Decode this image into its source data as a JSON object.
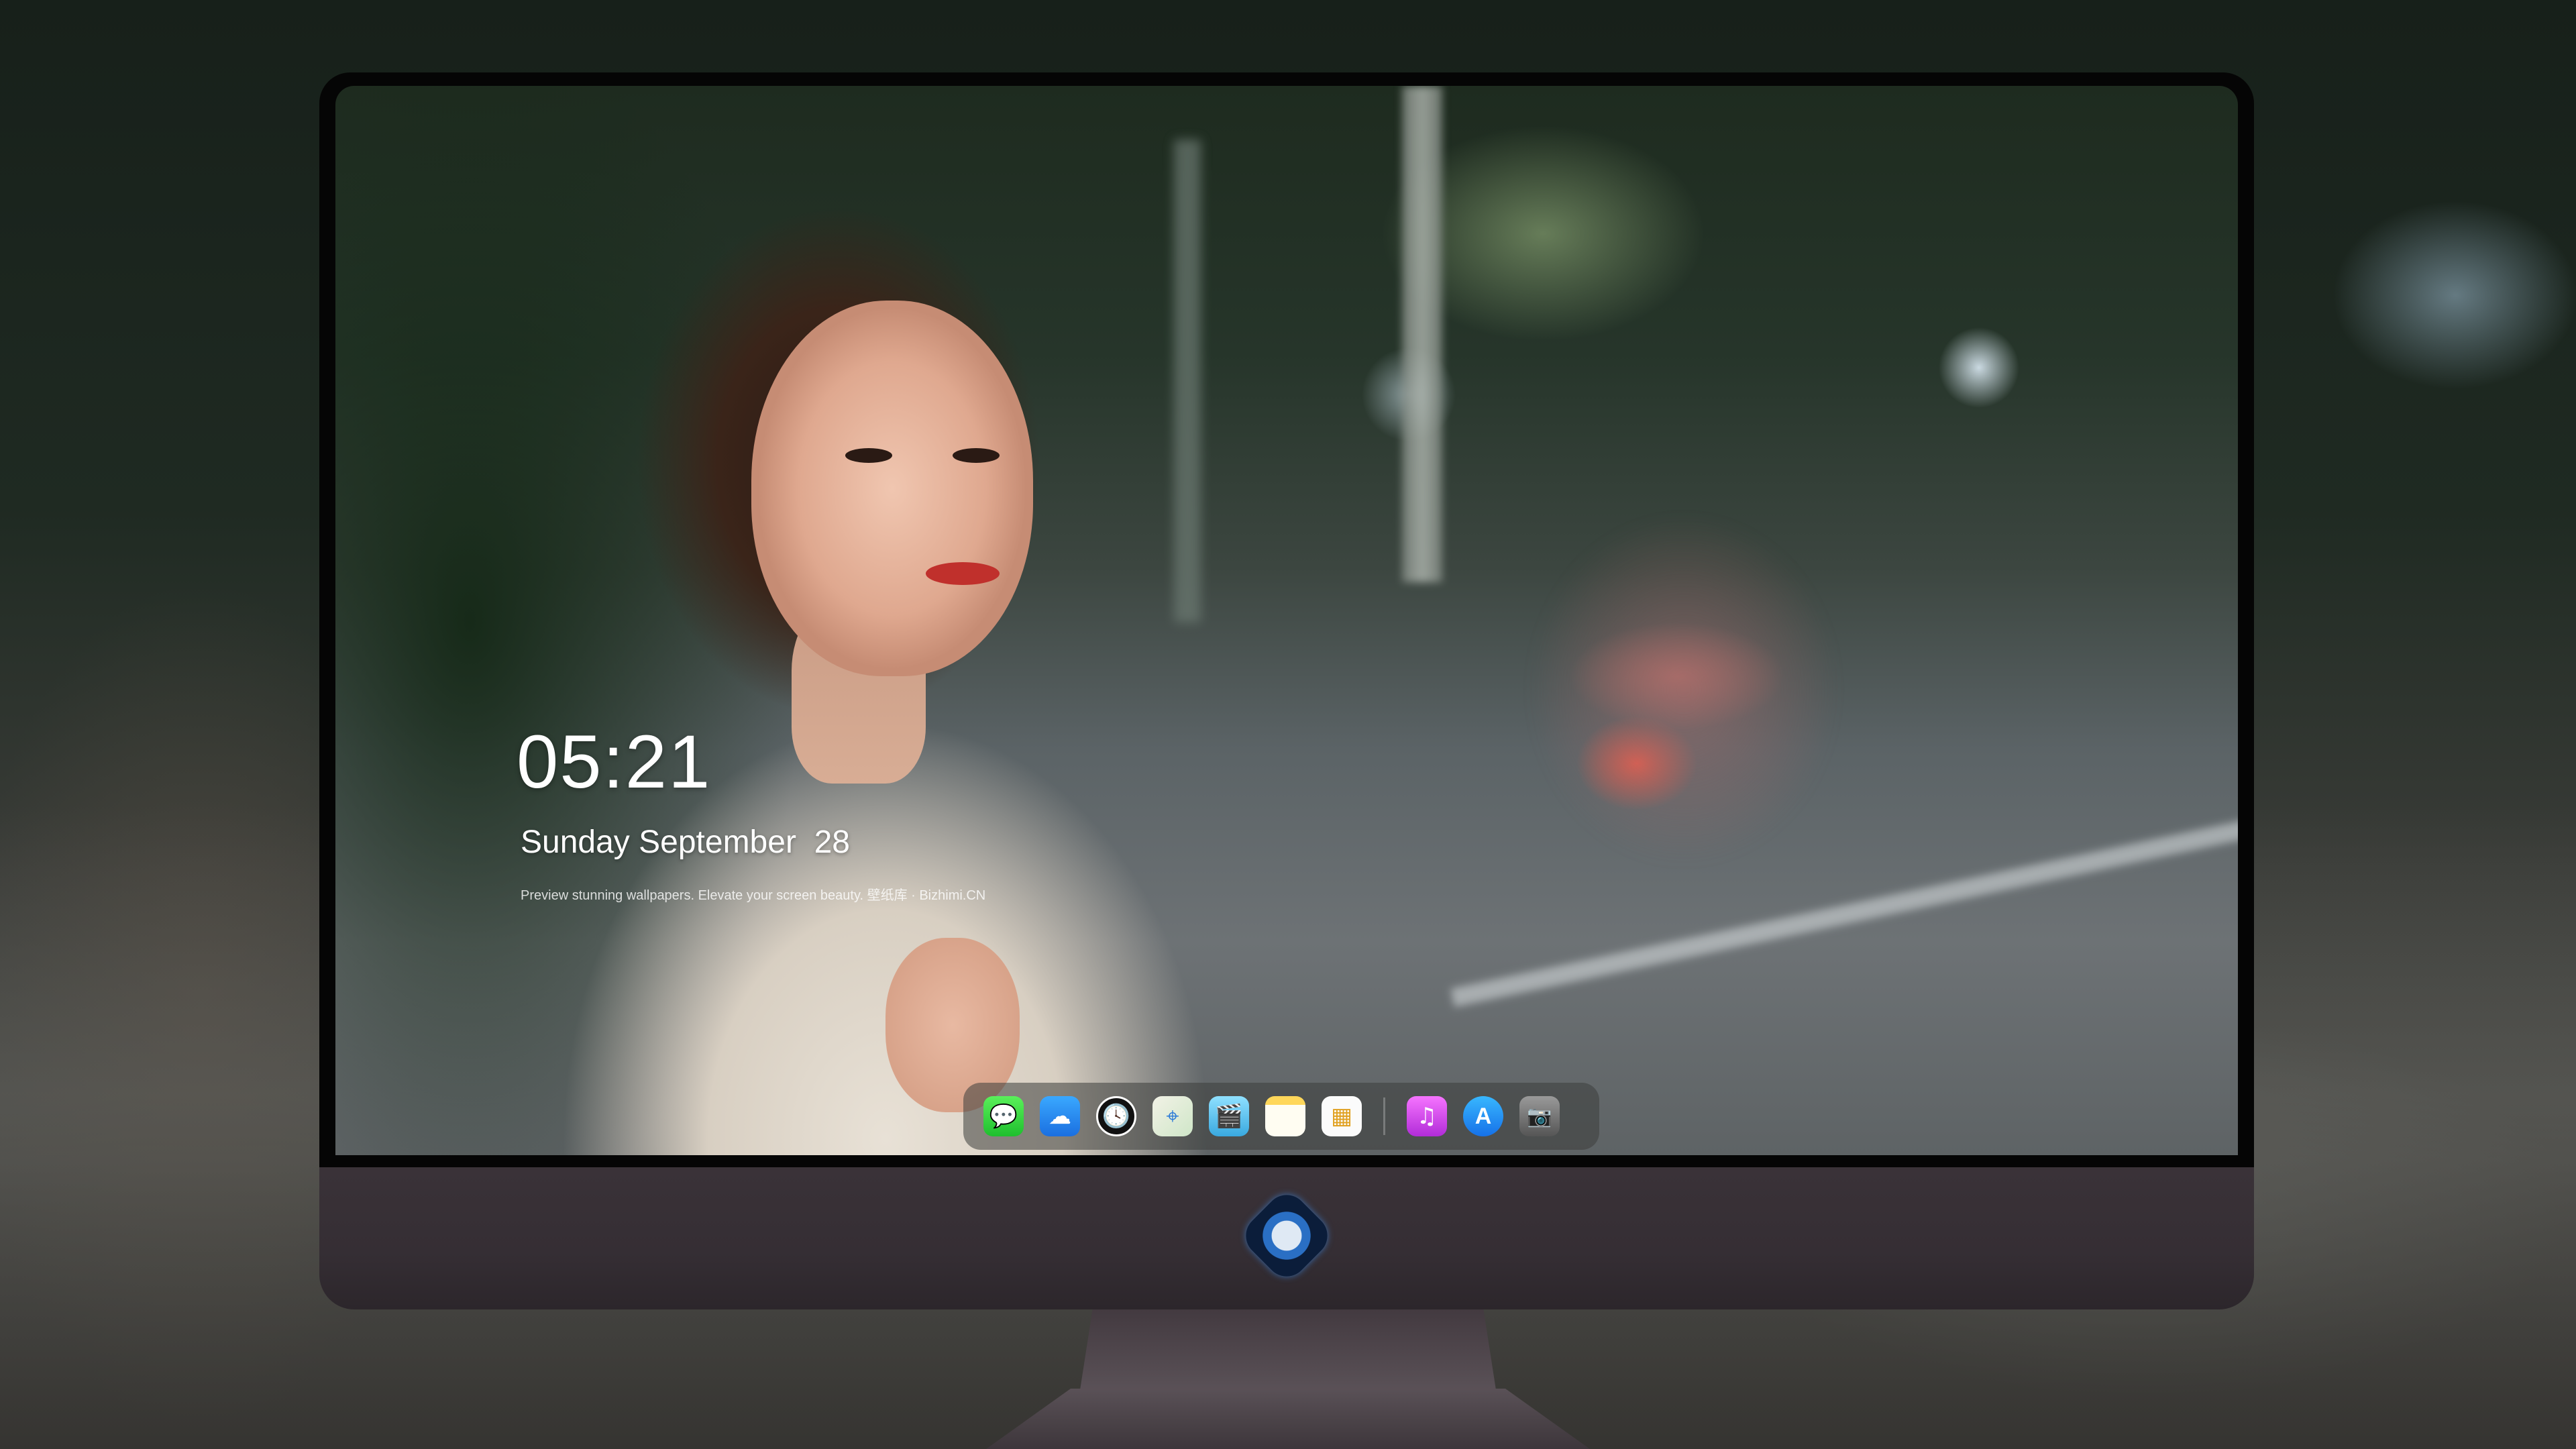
{
  "lock_screen": {
    "time": "05:21",
    "date": "Sunday September  28",
    "tagline": "Preview stunning wallpapers. Elevate your screen beauty. 壁纸库 · Bizhimi.CN"
  },
  "dock": {
    "apps": [
      {
        "name": "Messages",
        "icon": "messages-icon",
        "glyph": "💬"
      },
      {
        "name": "Weather",
        "icon": "weather-icon",
        "glyph": "☁"
      },
      {
        "name": "Clock",
        "icon": "clock-icon",
        "glyph": "🕓"
      },
      {
        "name": "Maps",
        "icon": "maps-icon",
        "glyph": "⌖"
      },
      {
        "name": "Clips",
        "icon": "clips-icon",
        "glyph": "🎬"
      },
      {
        "name": "Notes",
        "icon": "notes-icon",
        "glyph": ""
      },
      {
        "name": "Photos",
        "icon": "photos-icon",
        "glyph": "▦"
      },
      {
        "name": "iTunes",
        "icon": "itunes-icon",
        "glyph": "♫"
      },
      {
        "name": "App Store",
        "icon": "appstore-icon",
        "glyph": "A"
      },
      {
        "name": "Camera",
        "icon": "camera-icon",
        "glyph": "📷"
      }
    ]
  },
  "colors": {
    "monitor_chin": "#352e34",
    "bezel": "#050505",
    "dock_bg": "rgba(60,62,60,0.55)"
  }
}
